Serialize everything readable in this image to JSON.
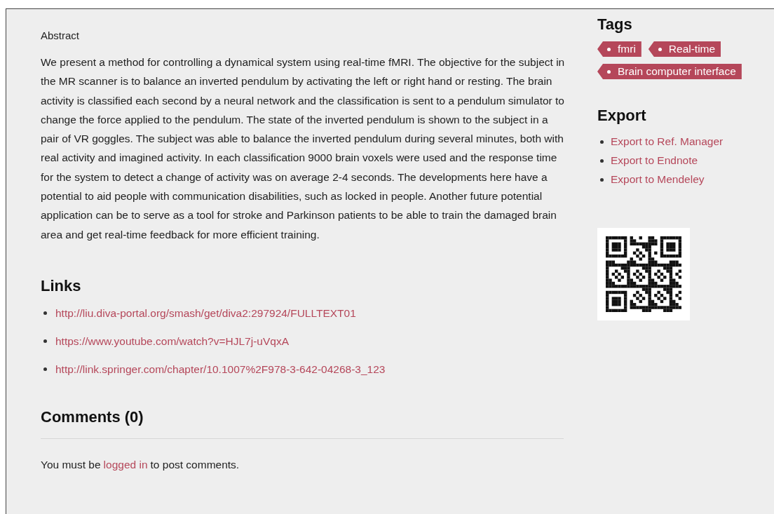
{
  "abstract": {
    "heading": "Abstract",
    "text": "We present a method for controlling a dynamical system using real-time fMRI. The objective for the subject in the MR scanner is to balance an inverted pendulum by activating the left or right hand or resting. The brain activity is classified each second by a neural network and the classification is sent to a pendulum simulator to change the force applied to the pendulum. The state of the inverted pendulum is shown to the subject in a pair of VR goggles. The subject was able to balance the inverted pendulum during several minutes, both with real activity and imagined activity. In each classification 9000 brain voxels were used and the response time for the system to detect a change of activity was on average 2-4 seconds. The developments here have a potential to aid people with communication disabilities, such as locked in people. Another future potential application can be to serve as a tool for stroke and Parkinson patients to be able to train the damaged brain area and get real-time feedback for more efficient training."
  },
  "links": {
    "heading": "Links",
    "items": [
      "http://liu.diva-portal.org/smash/get/diva2:297924/FULLTEXT01",
      "https://www.youtube.com/watch?v=HJL7j-uVqxA",
      "http://link.springer.com/chapter/10.1007%2F978-3-642-04268-3_123"
    ]
  },
  "comments": {
    "heading": "Comments (0)",
    "before": "You must be",
    "link": "logged in",
    "after": "to post comments."
  },
  "tags": {
    "heading": "Tags",
    "items": [
      "fmri",
      "Real-time",
      "Brain computer interface"
    ]
  },
  "export": {
    "heading": "Export",
    "items": [
      "Export to Ref. Manager",
      "Export to Endnote",
      "Export to Mendeley"
    ]
  }
}
